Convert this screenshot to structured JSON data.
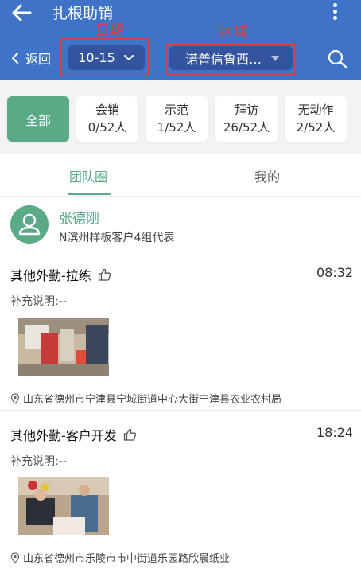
{
  "header": {
    "title": "扎根助销",
    "back_label": "返回",
    "date_value": "10-15",
    "area_value": "诺普信鲁西…",
    "annotations": {
      "date_label": "日期",
      "area_label": "区域"
    }
  },
  "filters": [
    {
      "label": "全部",
      "count": "",
      "active": true
    },
    {
      "label": "会销",
      "count": "0/52人",
      "active": false
    },
    {
      "label": "示范",
      "count": "1/52人",
      "active": false
    },
    {
      "label": "拜访",
      "count": "26/52人",
      "active": false
    },
    {
      "label": "无动作",
      "count": "2/52人",
      "active": false
    }
  ],
  "tabs": [
    {
      "label": "团队圈",
      "active": true
    },
    {
      "label": "我的",
      "active": false
    }
  ],
  "user": {
    "name": "张德刚",
    "group": "N滨州样板客户4组代表"
  },
  "posts": [
    {
      "title": "其他外勤-拉练",
      "time": "08:32",
      "note": "补充说明:--",
      "location": "山东省德州市宁津县宁城街道中心大街宁津县农业农村局"
    },
    {
      "title": "其他外勤-客户开发",
      "time": "18:24",
      "note": "补充说明:--",
      "location": "山东省德州市乐陵市市中街道乐园路欣晨纸业"
    }
  ],
  "colors": {
    "header_bg": "#3f73c8",
    "pill_bg": "#35549f",
    "accent": "#5aa987",
    "annotation": "#e23b3b"
  }
}
